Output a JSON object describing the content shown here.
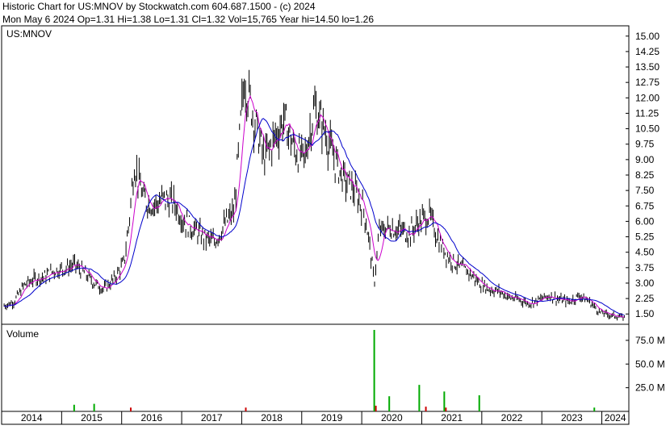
{
  "header": {
    "line1": "Historic Chart for US:MNOV by Stockwatch.com 604.687.1500 - (c) 2024",
    "line2": "Mon May  6 2024  Op=1.31  Hi=1.38  Lo=1.31  Cl=1.32  Vol=15,765  Year hi=14.50  lo=1.26"
  },
  "colors": {
    "price_bars": "#000000",
    "ma_short": "#cc00cc",
    "ma_long": "#0000cc",
    "volume_up": "#00aa00",
    "volume_down": "#cc0000",
    "frame": "#000000"
  },
  "chart_data": [
    {
      "type": "line",
      "title": "",
      "legend_label": "US:MNOV",
      "series": [
        {
          "values": [
            {
              "x": "2014-01",
              "y": 1.9
            },
            {
              "x": "2014-03",
              "y": 2.1
            },
            {
              "x": "2014-05",
              "y": 2.9
            },
            {
              "x": "2014-07",
              "y": 3.2
            },
            {
              "x": "2014-09",
              "y": 3.3
            },
            {
              "x": "2014-11",
              "y": 3.6
            },
            {
              "x": "2015-01",
              "y": 3.7
            },
            {
              "x": "2015-03",
              "y": 3.9
            },
            {
              "x": "2015-05",
              "y": 3.5
            },
            {
              "x": "2015-07",
              "y": 3.0
            },
            {
              "x": "2015-09",
              "y": 2.7
            },
            {
              "x": "2015-11",
              "y": 3.2
            },
            {
              "x": "2016-01",
              "y": 4.0
            },
            {
              "x": "2016-02",
              "y": 6.0
            },
            {
              "x": "2016-03",
              "y": 8.8
            },
            {
              "x": "2016-05",
              "y": 7.0
            },
            {
              "x": "2016-07",
              "y": 6.8
            },
            {
              "x": "2016-09",
              "y": 7.1
            },
            {
              "x": "2016-11",
              "y": 6.9
            },
            {
              "x": "2017-01",
              "y": 6.0
            },
            {
              "x": "2017-03",
              "y": 5.6
            },
            {
              "x": "2017-05",
              "y": 5.2
            },
            {
              "x": "2017-07",
              "y": 5.0
            },
            {
              "x": "2017-09",
              "y": 5.8
            },
            {
              "x": "2017-11",
              "y": 6.5
            },
            {
              "x": "2018-01",
              "y": 13.0
            },
            {
              "x": "2018-03",
              "y": 11.0
            },
            {
              "x": "2018-05",
              "y": 9.0
            },
            {
              "x": "2018-07",
              "y": 10.0
            },
            {
              "x": "2018-09",
              "y": 11.0
            },
            {
              "x": "2018-11",
              "y": 9.5
            },
            {
              "x": "2019-01",
              "y": 9.0
            },
            {
              "x": "2019-03",
              "y": 11.5
            },
            {
              "x": "2019-05",
              "y": 10.5
            },
            {
              "x": "2019-07",
              "y": 9.0
            },
            {
              "x": "2019-09",
              "y": 8.0
            },
            {
              "x": "2019-11",
              "y": 7.5
            },
            {
              "x": "2020-01",
              "y": 6.5
            },
            {
              "x": "2020-02",
              "y": 5.0
            },
            {
              "x": "2020-03",
              "y": 3.0
            },
            {
              "x": "2020-04",
              "y": 5.5
            },
            {
              "x": "2020-06",
              "y": 5.7
            },
            {
              "x": "2020-08",
              "y": 5.6
            },
            {
              "x": "2020-10",
              "y": 5.4
            },
            {
              "x": "2020-12",
              "y": 6.0
            },
            {
              "x": "2021-02",
              "y": 6.3
            },
            {
              "x": "2021-04",
              "y": 5.0
            },
            {
              "x": "2021-06",
              "y": 4.2
            },
            {
              "x": "2021-08",
              "y": 3.8
            },
            {
              "x": "2021-10",
              "y": 3.5
            },
            {
              "x": "2021-12",
              "y": 3.0
            },
            {
              "x": "2022-02",
              "y": 2.7
            },
            {
              "x": "2022-04",
              "y": 2.6
            },
            {
              "x": "2022-06",
              "y": 2.3
            },
            {
              "x": "2022-08",
              "y": 2.2
            },
            {
              "x": "2022-10",
              "y": 2.0
            },
            {
              "x": "2022-12",
              "y": 2.2
            },
            {
              "x": "2023-02",
              "y": 2.4
            },
            {
              "x": "2023-04",
              "y": 2.2
            },
            {
              "x": "2023-06",
              "y": 2.1
            },
            {
              "x": "2023-08",
              "y": 2.4
            },
            {
              "x": "2023-10",
              "y": 2.1
            },
            {
              "x": "2023-12",
              "y": 1.6
            },
            {
              "x": "2024-02",
              "y": 1.45
            },
            {
              "x": "2024-05",
              "y": 1.32
            }
          ]
        }
      ],
      "ylim": [
        1.0,
        15.5
      ],
      "y_ticks": [
        "15.00",
        "14.25",
        "13.50",
        "12.75",
        "12.00",
        "11.25",
        "10.50",
        "9.75",
        "9.00",
        "8.25",
        "7.50",
        "6.75",
        "6.00",
        "5.25",
        "4.50",
        "3.75",
        "3.00",
        "2.25",
        "1.50"
      ],
      "grid": false
    },
    {
      "type": "bar",
      "title": "",
      "legend_label": "Volume",
      "series": [
        {
          "values": [
            {
              "x": "2015-03",
              "y": 7,
              "up": true
            },
            {
              "x": "2015-07",
              "y": 8,
              "up": true
            },
            {
              "x": "2016-02",
              "y": 4,
              "up": false
            },
            {
              "x": "2018-01",
              "y": 4,
              "up": false
            },
            {
              "x": "2020-03",
              "y": 86,
              "up": true
            },
            {
              "x": "2020-03",
              "y": 6,
              "up": false
            },
            {
              "x": "2020-06",
              "y": 16,
              "up": true
            },
            {
              "x": "2020-12",
              "y": 28,
              "up": true
            },
            {
              "x": "2021-01",
              "y": 5,
              "up": false
            },
            {
              "x": "2021-05",
              "y": 21,
              "up": true
            },
            {
              "x": "2021-05",
              "y": 4,
              "up": false
            },
            {
              "x": "2021-12",
              "y": 17,
              "up": true
            },
            {
              "x": "2023-11",
              "y": 4,
              "up": true
            }
          ]
        }
      ],
      "ylabel": "",
      "y_unit": "M",
      "ylim": [
        0,
        92
      ],
      "y_ticks": [
        "75.0 M",
        "50.0 M",
        "25.0 M"
      ]
    }
  ],
  "x_axis": {
    "labels": [
      "2014",
      "2015",
      "2016",
      "2017",
      "2018",
      "2019",
      "2020",
      "2021",
      "2022",
      "2023",
      "2024"
    ]
  }
}
